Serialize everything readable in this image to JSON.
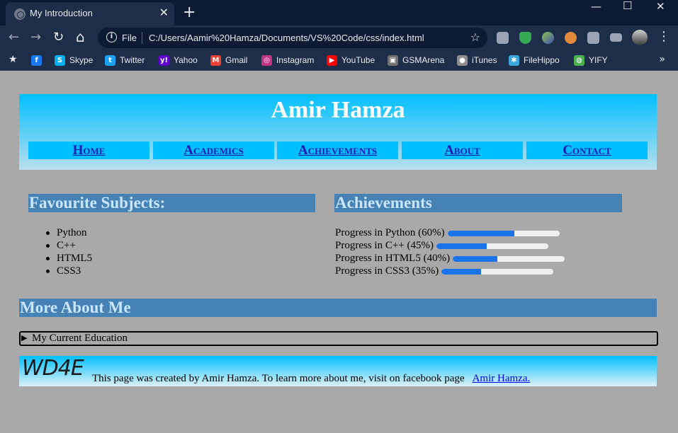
{
  "browser": {
    "tab_title": "My Introduction",
    "tab_close": "✕",
    "new_tab": "+",
    "window": {
      "minimize": "—",
      "maximize": "☐",
      "close": "✕"
    },
    "nav": {
      "back": "←",
      "forward": "→",
      "reload": "↻",
      "home": "⌂"
    },
    "omnibox": {
      "info": "i",
      "scheme_label": "File",
      "url": "C:/Users/Aamir%20Hamza/Documents/VS%20Code/css/index.html",
      "star": "☆"
    },
    "extensions": [
      {
        "name": "camera-icon",
        "color": "#9aa4b4"
      },
      {
        "name": "shield-extension-icon",
        "color": "#34a853"
      },
      {
        "name": "colorful-extension-icon",
        "color": "#8bc34a"
      },
      {
        "name": "face-extension-icon",
        "color": "#e08a3c"
      },
      {
        "name": "puzzle-icon",
        "color": "#9aa4b4"
      },
      {
        "name": "media-icon",
        "color": "#9aa4b4"
      },
      {
        "name": "profile-avatar",
        "color": "#cfcfcf"
      }
    ],
    "menu": "⋮",
    "bookmarks": [
      {
        "label": "",
        "icon": "f",
        "color": "#1877f2"
      },
      {
        "label": "Skype",
        "icon": "S",
        "color": "#00aff0"
      },
      {
        "label": "Twitter",
        "icon": "t",
        "color": "#1da1f2"
      },
      {
        "label": "Yahoo",
        "icon": "y!",
        "color": "#6001d2"
      },
      {
        "label": "Gmail",
        "icon": "M",
        "color": "#ea4335"
      },
      {
        "label": "Instagram",
        "icon": "◎",
        "color": "#c13584"
      },
      {
        "label": "YouTube",
        "icon": "▶",
        "color": "#ff0000"
      },
      {
        "label": "GSMArena",
        "icon": "▣",
        "color": "#6f6f6f"
      },
      {
        "label": "iTunes",
        "icon": "●",
        "color": "#8e8e8e"
      },
      {
        "label": "FileHippo",
        "icon": "✱",
        "color": "#3ba6dd"
      },
      {
        "label": "YIFY",
        "icon": "◍",
        "color": "#4caf50"
      }
    ],
    "bookmarks_more": "»"
  },
  "page": {
    "name": "Amir Hamza",
    "nav": [
      "Home",
      "Academics",
      "Achievements",
      "About",
      "Contact"
    ],
    "subjects_heading": "Favourite Subjects:",
    "subjects": [
      "Python",
      "C++",
      "HTML5",
      "CSS3"
    ],
    "achievements_heading": "Achievements",
    "progress": [
      {
        "label": "Progress in Python (60%)",
        "value": 0.6
      },
      {
        "label": "Progress in C++ (45%)",
        "value": 0.45
      },
      {
        "label": "Progress in HTML5 (40%)",
        "value": 0.4
      },
      {
        "label": "Progress in CSS3 (35%)",
        "value": 0.35
      }
    ],
    "more_heading": "More About Me",
    "details_summary": "My Current Education",
    "footer": {
      "logo": "WD4E",
      "text": "This page was created by Amir Hamza. To learn more about me, visit on facebook page",
      "link": "Amir Hamza."
    }
  }
}
